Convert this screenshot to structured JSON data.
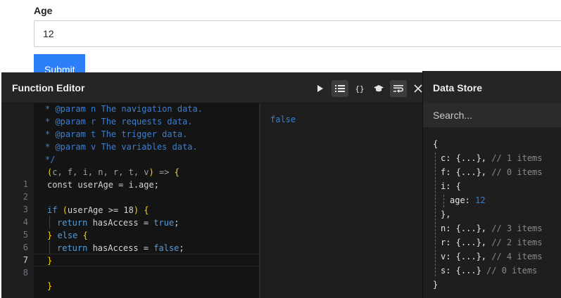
{
  "form": {
    "age_label": "Age",
    "age_value": "12",
    "submit_label": "Submit"
  },
  "function_editor": {
    "title": "Function Editor",
    "tools": [
      "run-icon",
      "list-icon",
      "braces-icon",
      "graduation-cap-icon",
      "wrap-icon",
      "close-icon"
    ],
    "doc_comment": [
      "* @param n The navigation data.",
      "* @param r The requests data.",
      "* @param t The trigger data.",
      "* @param v The variables data.",
      "*/"
    ],
    "signature_open": "(",
    "signature_params": "c, f, i, n, r, t, v",
    "signature_close": ")",
    "signature_arrow": " => ",
    "signature_brace": "{",
    "lines": {
      "l1": "const userAge = i.age;",
      "l3_kw": "if ",
      "l3_paren_open": "(",
      "l3_cond": "userAge >= 18",
      "l3_paren_close": ")",
      "l3_brace": " {",
      "l4_kw": "return ",
      "l4_expr": "hasAccess = ",
      "l4_bool": "true",
      "l4_semi": ";",
      "l5_brace": "}",
      "l5_kw": " else ",
      "l5_brace2": "{",
      "l6_kw": "return ",
      "l6_expr": "hasAccess = ",
      "l6_bool": "false",
      "l6_semi": ";",
      "l7_brace": "}",
      "closing_brace": "}"
    },
    "line_numbers": [
      "1",
      "2",
      "3",
      "4",
      "5",
      "6",
      "7",
      "8"
    ],
    "result": "false"
  },
  "data_store": {
    "title": "Data Store",
    "search_placeholder": "Search...",
    "tree": {
      "open": "{",
      "c_key": "c: {...},",
      "c_comment": " // 1 items",
      "f_key": "f: {...},",
      "f_comment": " // 0 items",
      "i_key": "i: {",
      "age_key": "age: ",
      "age_value": "12",
      "i_close": "},",
      "n_key": "n: {...},",
      "n_comment": " // 3 items",
      "r_key": "r: {...},",
      "r_comment": " // 2 items",
      "v_key": "v: {...},",
      "v_comment": " // 4 items",
      "s_key": "s: {...}",
      "s_comment": " // 0 items",
      "close": "}"
    }
  }
}
